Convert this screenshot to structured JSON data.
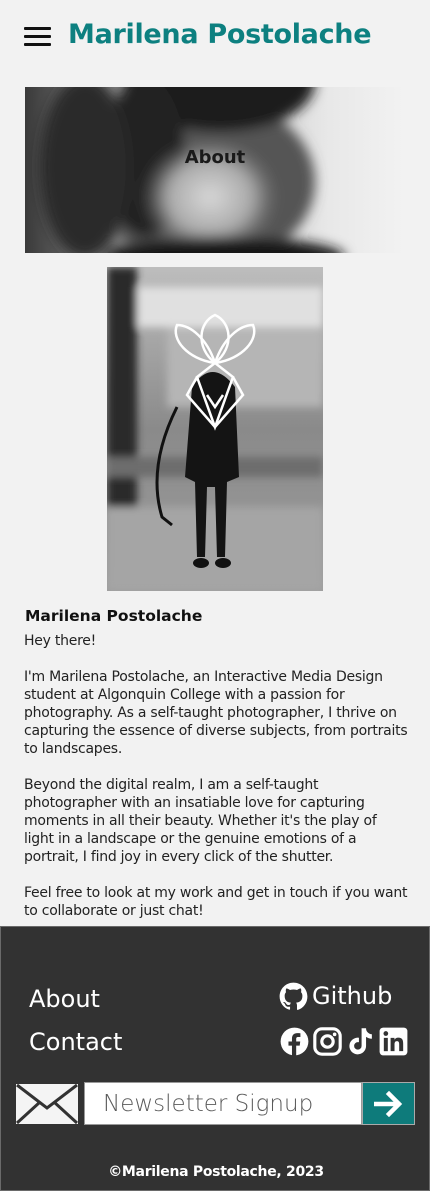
{
  "header": {
    "title": "Marilena Postolache"
  },
  "hero": {
    "title": "About"
  },
  "bio": {
    "name": "Marilena Postolache",
    "paragraphs": [
      "Hey there!",
      "I'm Marilena Postolache, an Interactive Media Design student at Algonquin College with a passion for photography. As a self-taught photographer, I thrive on capturing the essence of diverse subjects, from portraits to landscapes.",
      "Beyond the digital realm, I am a self-taught photographer with an insatiable love for capturing moments in all their beauty. Whether it's the play of light in a landscape or the genuine emotions of a portrait, I find joy in every click of the shutter.",
      "Feel free to look at my work and get in touch if you want to collaborate or just chat!"
    ]
  },
  "footer": {
    "nav": [
      "About",
      "Contact"
    ],
    "github_label": "Github",
    "socials": [
      "facebook-icon",
      "instagram-icon",
      "tiktok-icon",
      "linkedin-icon"
    ],
    "newsletter_placeholder": "Newsletter Signup",
    "copyright": "©Marilena Postolache, 2023"
  },
  "colors": {
    "brand": "#0d8080",
    "footer_bg": "#323232",
    "page_bg": "#f2f2f2",
    "button": "#0e7b7b"
  }
}
